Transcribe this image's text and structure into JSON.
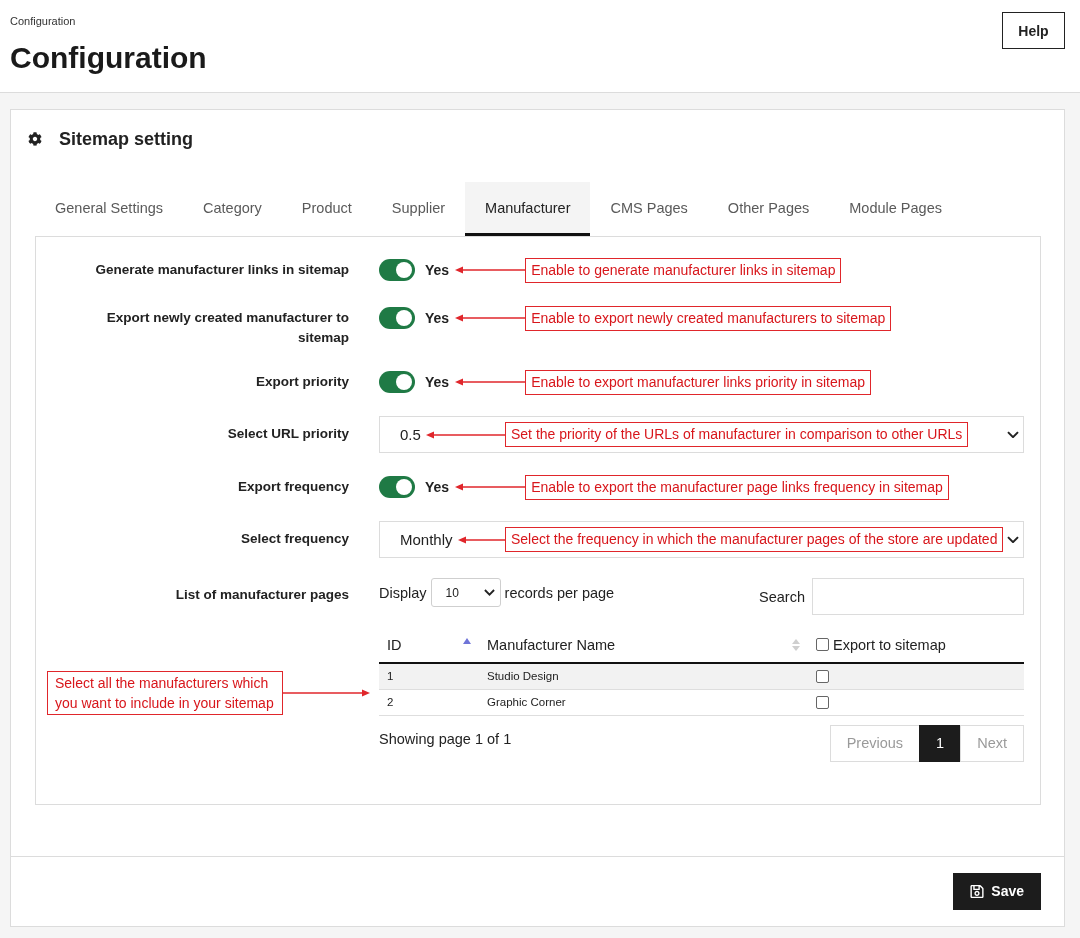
{
  "breadcrumb": "Configuration",
  "title": "Configuration",
  "help_button": "Help",
  "card": {
    "title": "Sitemap setting"
  },
  "tabs": [
    {
      "label": "General Settings",
      "selected": false
    },
    {
      "label": "Category",
      "selected": false
    },
    {
      "label": "Product",
      "selected": false
    },
    {
      "label": "Supplier",
      "selected": false
    },
    {
      "label": "Manufacturer",
      "selected": true
    },
    {
      "label": "CMS Pages",
      "selected": false
    },
    {
      "label": "Other Pages",
      "selected": false
    },
    {
      "label": "Module Pages",
      "selected": false
    }
  ],
  "settings": [
    {
      "kind": "toggle",
      "label": "Generate manufacturer links in sitemap",
      "on": true,
      "state_label": "Yes",
      "annotation": "Enable to generate manufacturer links in sitemap"
    },
    {
      "kind": "toggle",
      "label": "Export newly created manufacturer to sitemap",
      "on": true,
      "state_label": "Yes",
      "annotation": "Enable to export newly created manufacturers to sitemap"
    },
    {
      "kind": "toggle",
      "label": "Export priority",
      "on": true,
      "state_label": "Yes",
      "annotation": "Enable to export manufacturer links priority in sitemap"
    },
    {
      "kind": "select",
      "label": "Select URL priority",
      "value": "0.5",
      "annotation": "Set the priority of the URLs of manufacturer in comparison to other URLs"
    },
    {
      "kind": "toggle",
      "label": "Export frequency",
      "on": true,
      "state_label": "Yes",
      "annotation": "Enable to export the manufacturer page links frequency in sitemap"
    },
    {
      "kind": "select",
      "label": "Select frequency",
      "value": "Monthly",
      "annotation": "Select the frequency in which the manufacturer pages of the store are updated"
    }
  ],
  "manufacturer_list": {
    "label": "List of manufacturer pages",
    "annotation": "Select all the manufacturers which you want to include in your sitemap",
    "display_label": "Display",
    "page_size": "10",
    "per_page_label": "records per page",
    "search_label": "Search",
    "columns": [
      {
        "label": "ID",
        "kind": "sortable",
        "sorted": true
      },
      {
        "label": "Manufacturer Name",
        "kind": "sortable",
        "sorted": false
      },
      {
        "label": "Export to sitemap",
        "kind": "check",
        "checked": false
      }
    ],
    "rows": [
      {
        "id": "1",
        "name": "Studio Design",
        "export": false
      },
      {
        "id": "2",
        "name": "Graphic Corner",
        "export": false
      }
    ],
    "summary": "Showing page 1 of 1",
    "pagination": {
      "previous": {
        "label": "Previous",
        "disabled": true
      },
      "pages": [
        {
          "label": "1",
          "selected": true
        }
      ],
      "next": {
        "label": "Next",
        "disabled": true
      }
    }
  },
  "save_button": "Save"
}
